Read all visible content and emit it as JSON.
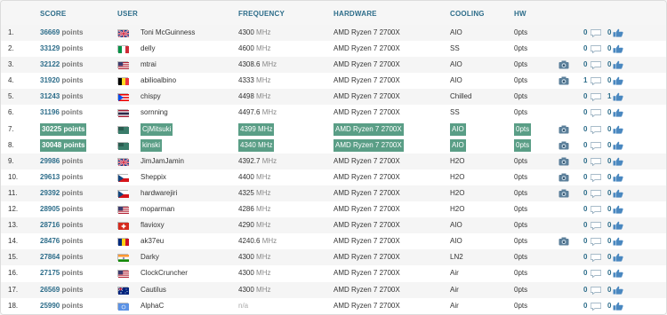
{
  "columns": {
    "score": "SCORE",
    "user": "USER",
    "frequency": "FREQUENCY",
    "hardware": "HARDWARE",
    "cooling": "COOLING",
    "hw": "HW"
  },
  "rows": [
    {
      "rank": "1.",
      "score": "36669",
      "pts_label": "points",
      "flag": "gb",
      "user": "Toni McGuinness",
      "freq": "4300",
      "freq_unit": "MHz",
      "hardware": "AMD Ryzen 7 2700X",
      "cooling": "AIO",
      "hw_pts": "0pts",
      "camera": false,
      "comments": "0",
      "likes": "0",
      "highlight": false
    },
    {
      "rank": "2.",
      "score": "33129",
      "pts_label": "points",
      "flag": "it",
      "user": "delly",
      "freq": "4600",
      "freq_unit": "MHz",
      "hardware": "AMD Ryzen 7 2700X",
      "cooling": "SS",
      "hw_pts": "0pts",
      "camera": false,
      "comments": "0",
      "likes": "0",
      "highlight": false
    },
    {
      "rank": "3.",
      "score": "32122",
      "pts_label": "points",
      "flag": "us",
      "user": "mtrai",
      "freq": "4308.6",
      "freq_unit": "MHz",
      "hardware": "AMD Ryzen 7 2700X",
      "cooling": "AIO",
      "hw_pts": "0pts",
      "camera": true,
      "comments": "0",
      "likes": "0",
      "highlight": false
    },
    {
      "rank": "4.",
      "score": "31920",
      "pts_label": "points",
      "flag": "be",
      "user": "abilioalbino",
      "freq": "4333",
      "freq_unit": "MHz",
      "hardware": "AMD Ryzen 7 2700X",
      "cooling": "AIO",
      "hw_pts": "0pts",
      "camera": true,
      "comments": "1",
      "likes": "0",
      "highlight": false
    },
    {
      "rank": "5.",
      "score": "31243",
      "pts_label": "points",
      "flag": "pr",
      "user": "chispy",
      "freq": "4498",
      "freq_unit": "MHz",
      "hardware": "AMD Ryzen 7 2700X",
      "cooling": "Chilled",
      "hw_pts": "0pts",
      "camera": false,
      "comments": "0",
      "likes": "1",
      "highlight": false
    },
    {
      "rank": "6.",
      "score": "31196",
      "pts_label": "points",
      "flag": "th",
      "user": "sornning",
      "freq": "4497.6",
      "freq_unit": "MHz",
      "hardware": "AMD Ryzen 7 2700X",
      "cooling": "SS",
      "hw_pts": "0pts",
      "camera": false,
      "comments": "0",
      "likes": "0",
      "highlight": false
    },
    {
      "rank": "7.",
      "score": "30225",
      "pts_label": "points",
      "flag": "tw",
      "user": "CjMitsuki",
      "freq": "4399",
      "freq_unit": "MHz",
      "hardware": "AMD Ryzen 7 2700X",
      "cooling": "AIO",
      "hw_pts": "0pts",
      "camera": true,
      "comments": "0",
      "likes": "0",
      "highlight": true
    },
    {
      "rank": "8.",
      "score": "30048",
      "pts_label": "points",
      "flag": "tw",
      "user": "kinski",
      "freq": "4340",
      "freq_unit": "MHz",
      "hardware": "AMD Ryzen 7 2700X",
      "cooling": "AIO",
      "hw_pts": "0pts",
      "camera": true,
      "comments": "0",
      "likes": "0",
      "highlight": true
    },
    {
      "rank": "9.",
      "score": "29986",
      "pts_label": "points",
      "flag": "gb",
      "user": "JimJamJamin",
      "freq": "4392.7",
      "freq_unit": "MHz",
      "hardware": "AMD Ryzen 7 2700X",
      "cooling": "H2O",
      "hw_pts": "0pts",
      "camera": true,
      "comments": "0",
      "likes": "0",
      "highlight": false
    },
    {
      "rank": "10.",
      "score": "29613",
      "pts_label": "points",
      "flag": "cz",
      "user": "Sheppix",
      "freq": "4400",
      "freq_unit": "MHz",
      "hardware": "AMD Ryzen 7 2700X",
      "cooling": "H2O",
      "hw_pts": "0pts",
      "camera": true,
      "comments": "0",
      "likes": "0",
      "highlight": false
    },
    {
      "rank": "11.",
      "score": "29392",
      "pts_label": "points",
      "flag": "cz",
      "user": "hardwarejiri",
      "freq": "4325",
      "freq_unit": "MHz",
      "hardware": "AMD Ryzen 7 2700X",
      "cooling": "H2O",
      "hw_pts": "0pts",
      "camera": true,
      "comments": "0",
      "likes": "0",
      "highlight": false
    },
    {
      "rank": "12.",
      "score": "28905",
      "pts_label": "points",
      "flag": "us",
      "user": "moparman",
      "freq": "4286",
      "freq_unit": "MHz",
      "hardware": "AMD Ryzen 7 2700X",
      "cooling": "H2O",
      "hw_pts": "0pts",
      "camera": false,
      "comments": "0",
      "likes": "0",
      "highlight": false
    },
    {
      "rank": "13.",
      "score": "28716",
      "pts_label": "points",
      "flag": "ch",
      "user": "flavioxy",
      "freq": "4290",
      "freq_unit": "MHz",
      "hardware": "AMD Ryzen 7 2700X",
      "cooling": "AIO",
      "hw_pts": "0pts",
      "camera": false,
      "comments": "0",
      "likes": "0",
      "highlight": false
    },
    {
      "rank": "14.",
      "score": "28476",
      "pts_label": "points",
      "flag": "ro",
      "user": "ak37eu",
      "freq": "4240.6",
      "freq_unit": "MHz",
      "hardware": "AMD Ryzen 7 2700X",
      "cooling": "AIO",
      "hw_pts": "0pts",
      "camera": true,
      "comments": "0",
      "likes": "0",
      "highlight": false
    },
    {
      "rank": "15.",
      "score": "27864",
      "pts_label": "points",
      "flag": "in",
      "user": "Darky",
      "freq": "4300",
      "freq_unit": "MHz",
      "hardware": "AMD Ryzen 7 2700X",
      "cooling": "LN2",
      "hw_pts": "0pts",
      "camera": false,
      "comments": "0",
      "likes": "0",
      "highlight": false
    },
    {
      "rank": "16.",
      "score": "27175",
      "pts_label": "points",
      "flag": "us",
      "user": "ClockCruncher",
      "freq": "4300",
      "freq_unit": "MHz",
      "hardware": "AMD Ryzen 7 2700X",
      "cooling": "Air",
      "hw_pts": "0pts",
      "camera": false,
      "comments": "0",
      "likes": "0",
      "highlight": false
    },
    {
      "rank": "17.",
      "score": "26569",
      "pts_label": "points",
      "flag": "au",
      "user": "Cautilus",
      "freq": "4300",
      "freq_unit": "MHz",
      "hardware": "AMD Ryzen 7 2700X",
      "cooling": "Air",
      "hw_pts": "0pts",
      "camera": false,
      "comments": "0",
      "likes": "0",
      "highlight": false
    },
    {
      "rank": "18.",
      "score": "25990",
      "pts_label": "points",
      "flag": "un",
      "user": "AlphaC",
      "freq": "n/a",
      "freq_unit": "",
      "hardware": "AMD Ryzen 7 2700X",
      "cooling": "Air",
      "hw_pts": "0pts",
      "camera": false,
      "comments": "0",
      "likes": "0",
      "highlight": false
    }
  ],
  "colors": {
    "accent": "#2d6d8a",
    "highlight": "#5a9e86",
    "icon": "#5b8fb0"
  },
  "icons": {
    "camera": "camera-icon",
    "comment": "comment-icon",
    "like": "thumbs-up-icon"
  }
}
